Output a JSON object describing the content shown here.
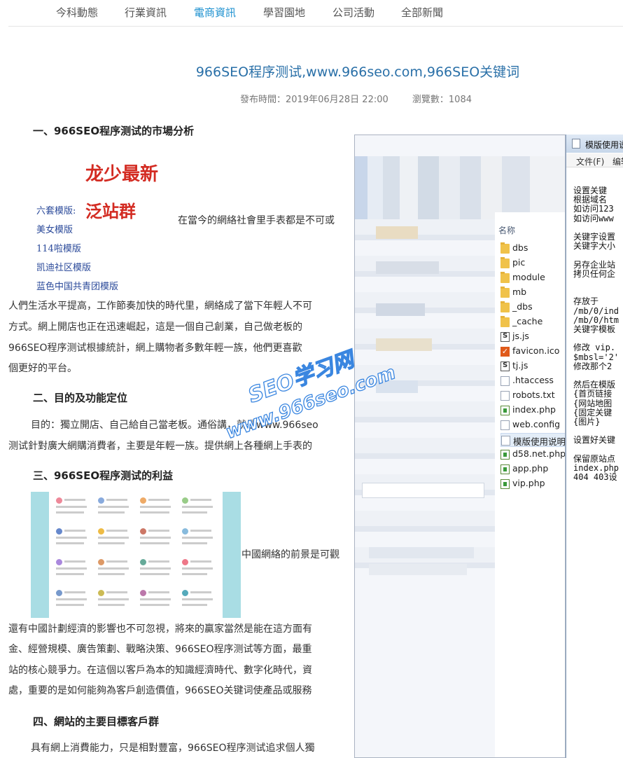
{
  "nav": {
    "items": [
      {
        "label": "今科動態",
        "active": false
      },
      {
        "label": "行業資訊",
        "active": false
      },
      {
        "label": "電商資訊",
        "active": true
      },
      {
        "label": "學習園地",
        "active": false
      },
      {
        "label": "公司活動",
        "active": false
      },
      {
        "label": "全部新聞",
        "active": false
      }
    ],
    "active_color": "#1a8fcf"
  },
  "article": {
    "title": "966SEO程序测试,www.966seo.com,966SEO关键词",
    "publish_time": "發布時間：2019年06月28日 22:00",
    "views": "瀏覽數：1084",
    "sections": [
      {
        "heading": "一、966SEO程序测试的市場分析"
      },
      {
        "heading": "二、目的及功能定位"
      },
      {
        "heading": "三、966SEO程序测试的利益"
      },
      {
        "heading": "四、網站的主要目標客戶群"
      }
    ],
    "paragraphs": {
      "p1_inline": "在當今的網絡社會里手表都是不可或",
      "p1_l2": "人們生活水平提高，工作節奏加快的時代里，網絡成了當下年輕人不可",
      "p1_l3": "方式。網上開店也正在迅速崛起，這是一個自己創業，自己做老板的",
      "p1_l4": "966SEO程序测试根據統計，網上購物者多數年輕一族，他們更喜歡",
      "p1_l5": "個更好的平台。",
      "p2_l1": "目的：獨立開店、自己給自己當老板。通俗講，就是www.966seo",
      "p2_l2": "测试針對廣大網購消費者，主要是年輕一族。提供網上各種網上手表的",
      "p3_inline": "中國網絡的前景是可觀",
      "p3_l2": "還有中國計劃經濟的影響也不可忽視，將來的贏家當然是能在這方面有",
      "p3_l3": "金、經營規模、廣告策劃、戰略決策、966SEO程序测试等方面，最重",
      "p3_l4": "站的核心競爭力。在這個以客戶為本的知識經濟時代、數字化時代，資",
      "p3_l5": "處，重要的是如何能夠為客戶創造價值，966SEO关键词使產品或服務",
      "p4_l1": "具有網上消費能力，只是相對豐富，966SEO程序测试追求個人獨"
    }
  },
  "promo_image": {
    "headline": "龙少最新",
    "subheadline": "泛站群",
    "menu": [
      "六套模版:",
      "美女模版",
      "114啦模版",
      "凯迪社区模版",
      "蓝色中国共青团模版"
    ]
  },
  "watermark": {
    "line1": "SEO学习网",
    "line2": "www.966seo.com",
    "color": "#3a86e0"
  },
  "explorer": {
    "column_header": "名称",
    "files": [
      {
        "name": "dbs",
        "icon": "folder-icon"
      },
      {
        "name": "pic",
        "icon": "folder-icon"
      },
      {
        "name": "module",
        "icon": "folder-icon"
      },
      {
        "name": "mb",
        "icon": "folder-icon"
      },
      {
        "name": "_dbs",
        "icon": "folder-icon"
      },
      {
        "name": "_cache",
        "icon": "folder-icon"
      },
      {
        "name": "js.js",
        "icon": "js-file-icon"
      },
      {
        "name": "favicon.ico",
        "icon": "favicon-icon"
      },
      {
        "name": "tj.js",
        "icon": "js-file-icon"
      },
      {
        "name": ".htaccess",
        "icon": "document-icon"
      },
      {
        "name": "robots.txt",
        "icon": "document-icon"
      },
      {
        "name": "index.php",
        "icon": "php-file-icon"
      },
      {
        "name": "web.config",
        "icon": "document-icon"
      },
      {
        "name": "模版使用说明.",
        "icon": "document-icon",
        "selected": true
      },
      {
        "name": "d58.net.php",
        "icon": "php-file-icon"
      },
      {
        "name": "app.php",
        "icon": "php-file-icon"
      },
      {
        "name": "vip.php",
        "icon": "php-file-icon"
      }
    ]
  },
  "notepad": {
    "title": "模版使用说",
    "menu": [
      "文件(F)",
      "编辑"
    ],
    "lines": [
      "设置关键",
      "根据域名",
      "如访问123",
      "如访问www",
      "",
      "关键字设置",
      "关键字大小",
      "",
      "另存企业站",
      "拷贝任何企",
      "",
      "",
      "存放于",
      "/mb/0/ind",
      "/mb/0/htm",
      "关键字模板",
      "",
      "修改 vip.",
      "$mbsl='2'",
      "修改那个2",
      "",
      "然后在模版",
      "{首页链接",
      "{网站地图",
      "{固定关键",
      "{图片}",
      "",
      "设置好关键",
      "",
      "保留原站点",
      "index.php",
      "404 403设"
    ]
  }
}
